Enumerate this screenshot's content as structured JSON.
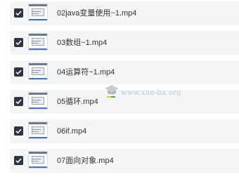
{
  "files": [
    {
      "name": "02java变量使用~1.mp4",
      "checked": true
    },
    {
      "name": "03数组~1.mp4",
      "checked": true
    },
    {
      "name": "04运算符~1.mp4",
      "checked": true
    },
    {
      "name": "05循环.mp4",
      "checked": true
    },
    {
      "name": "06if.mp4",
      "checked": true
    },
    {
      "name": "07面向对象.mp4",
      "checked": true
    }
  ],
  "watermark": {
    "text": "www.xue-ba.org"
  },
  "colors": {
    "row_bg": "#f4f5f7",
    "checkbox": "#2f3440",
    "text": "#333333"
  }
}
